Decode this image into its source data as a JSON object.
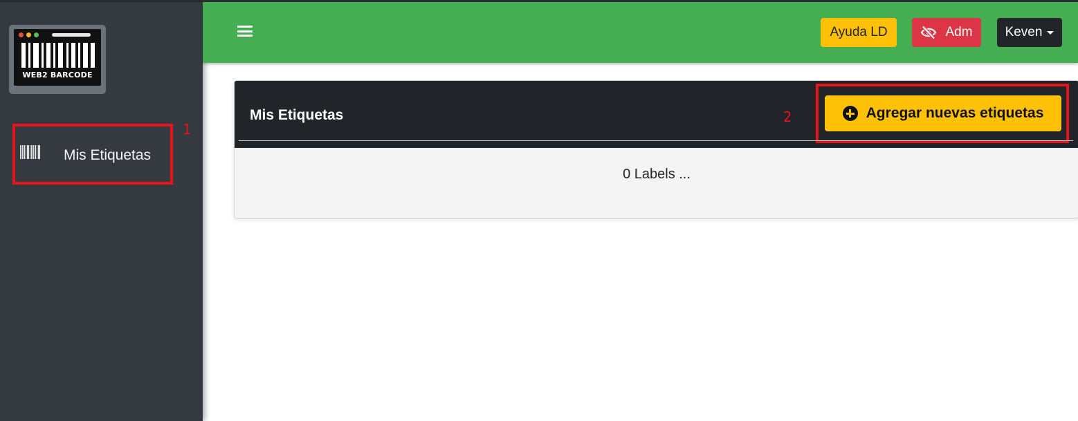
{
  "app": {
    "logo_text": "WEB2 BARCODE",
    "accent_green": "#45ad52",
    "annotation_color": "#e8141b"
  },
  "sidebar": {
    "items": [
      {
        "label": "Mis Etiquetas",
        "icon": "barcode-icon"
      }
    ],
    "annotation": "1"
  },
  "header": {
    "menu_icon": "hamburger-icon",
    "help_label": "Ayuda LD",
    "admin_label": "Adm",
    "admin_icon": "eye-slash-icon",
    "user_label": "Keven"
  },
  "main": {
    "card_title": "Mis Etiquetas",
    "annotation": "2",
    "add_button_label": "Agregar nuevas etiquetas",
    "add_button_icon": "plus-circle-icon",
    "empty_text": "0 Labels ..."
  }
}
